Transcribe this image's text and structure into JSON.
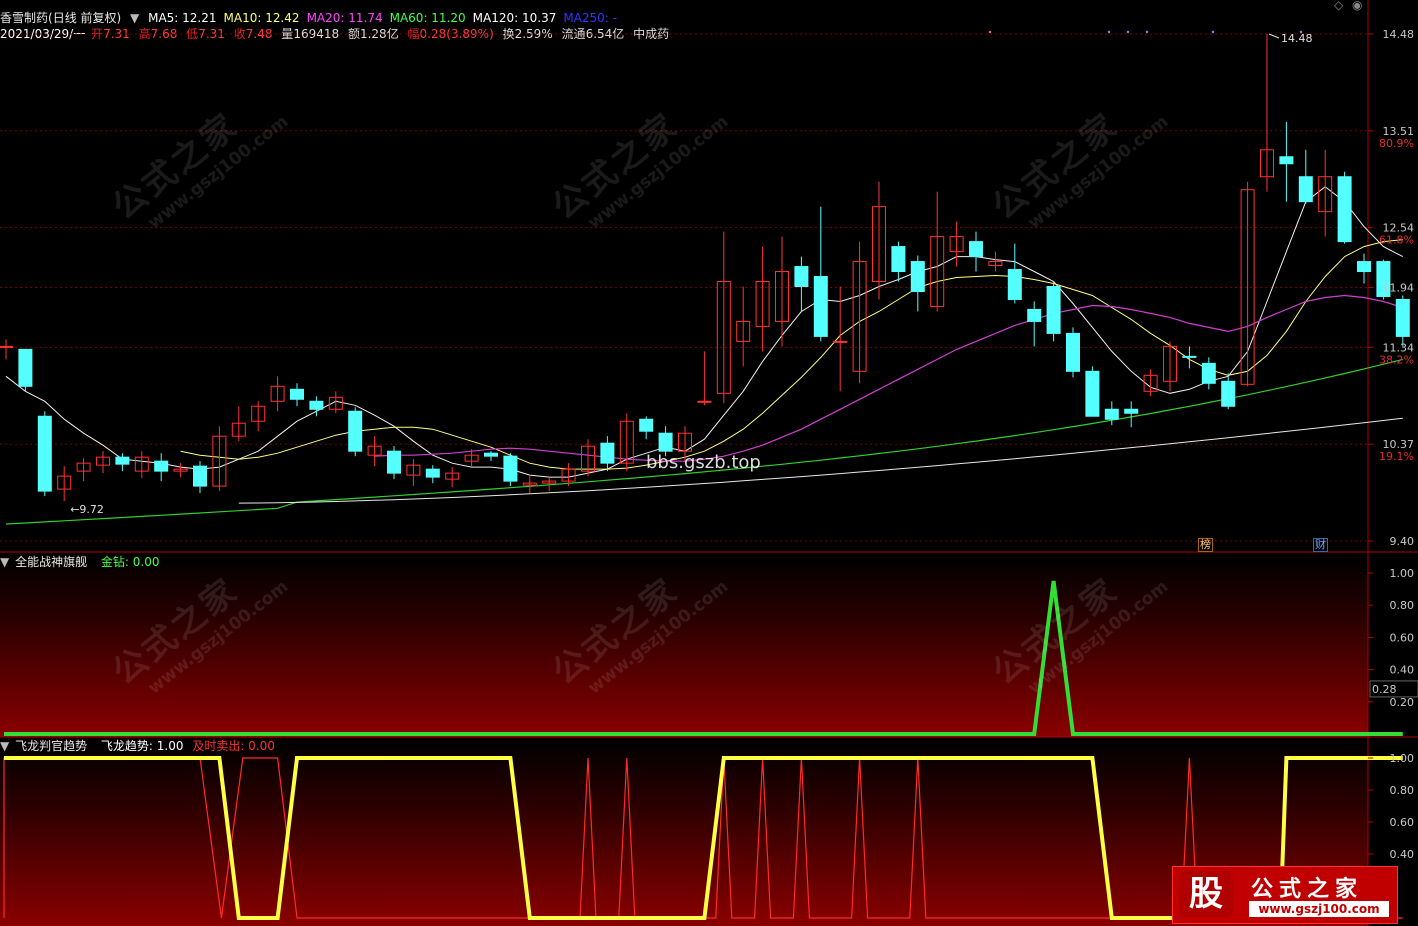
{
  "stock": {
    "name": "香雪制药",
    "mode": "(日线 前复权)",
    "quote_line": {
      "date": "2021/03/29/一",
      "open_label": "开",
      "open": "7.31",
      "high_label": "高",
      "high": "7.68",
      "low_label": "低",
      "low": "7.31",
      "close_label": "收",
      "close": "7.48",
      "vol_label": "量",
      "vol": "169418",
      "amount_label": "额",
      "amount": "1.28亿",
      "chg_label": "幅",
      "chg": "0.28(3.89%)",
      "turnover_label": "换",
      "turnover": "2.59%",
      "float_label": "流通",
      "float": "6.54亿",
      "industry": "中成药"
    }
  },
  "ma_legend": [
    {
      "label": "MA5: 12.21",
      "color": "#ffffff"
    },
    {
      "label": "MA10: 12.42",
      "color": "#ffff66"
    },
    {
      "label": "MA20: 11.74",
      "color": "#ff44ff"
    },
    {
      "label": "MA60: 11.20",
      "color": "#44ff44"
    },
    {
      "label": "MA120: 10.37",
      "color": "#ffffff"
    },
    {
      "label": "MA250: -",
      "color": "#3333ff"
    }
  ],
  "main_axis": {
    "ticks": [
      "14.48",
      "13.51",
      "12.54",
      "11.94",
      "11.34",
      "10.37",
      "9.40"
    ],
    "tick_values": [
      14.48,
      13.51,
      12.54,
      11.94,
      11.34,
      10.37,
      9.4
    ],
    "fib_labels": [
      "80.9%",
      "61.8%",
      "38.2%",
      "19.1%"
    ],
    "fib_values": [
      13.51,
      12.54,
      11.34,
      10.37
    ],
    "high_marker": "14.48",
    "low_marker": "9.72",
    "tags": [
      "榜",
      "财"
    ]
  },
  "watermarks": {
    "line1": "公式之家",
    "line2": "www.gszj100.com",
    "site": "bbs.gszb.top"
  },
  "panel2": {
    "title": "全能战神旗舰",
    "indicator_label": "金钻: 0.00",
    "ticks": [
      "1.00",
      "0.80",
      "0.60",
      "0.40",
      "0.20"
    ],
    "cursor_value": "0.28"
  },
  "panel3": {
    "title": "飞龙判官趋势",
    "indicator_label": "飞龙趋势: 1.00",
    "sell_label": "及时卖出: 0.00",
    "ticks": [
      "1.00",
      "0.80",
      "0.60",
      "0.40"
    ]
  },
  "logo": {
    "mark": "股",
    "name": "公式之家",
    "url": "www.gszj100.com"
  },
  "colors": {
    "up": "#ff3232",
    "down": "#54ffff",
    "grid": "#8b0000"
  },
  "chart_data": {
    "type": "candlestick",
    "candles": [
      {
        "o": 11.35,
        "c": 11.35,
        "h": 11.42,
        "l": 11.22
      },
      {
        "o": 11.32,
        "c": 10.95,
        "h": 11.32,
        "l": 10.9
      },
      {
        "o": 10.65,
        "c": 9.9,
        "h": 10.7,
        "l": 9.85
      },
      {
        "o": 9.92,
        "c": 10.05,
        "h": 10.15,
        "l": 9.8
      },
      {
        "o": 10.1,
        "c": 10.18,
        "h": 10.23,
        "l": 10.0
      },
      {
        "o": 10.16,
        "c": 10.24,
        "h": 10.3,
        "l": 10.08
      },
      {
        "o": 10.24,
        "c": 10.17,
        "h": 10.28,
        "l": 10.1
      },
      {
        "o": 10.1,
        "c": 10.24,
        "h": 10.3,
        "l": 10.03
      },
      {
        "o": 10.2,
        "c": 10.1,
        "h": 10.28,
        "l": 10.0
      },
      {
        "o": 10.1,
        "c": 10.12,
        "h": 10.18,
        "l": 10.04
      },
      {
        "o": 10.15,
        "c": 9.95,
        "h": 10.2,
        "l": 9.88
      },
      {
        "o": 9.95,
        "c": 10.45,
        "h": 10.55,
        "l": 9.9
      },
      {
        "o": 10.45,
        "c": 10.58,
        "h": 10.75,
        "l": 10.4
      },
      {
        "o": 10.6,
        "c": 10.75,
        "h": 10.8,
        "l": 10.5
      },
      {
        "o": 10.8,
        "c": 10.95,
        "h": 11.05,
        "l": 10.7
      },
      {
        "o": 10.92,
        "c": 10.82,
        "h": 10.98,
        "l": 10.75
      },
      {
        "o": 10.8,
        "c": 10.72,
        "h": 10.85,
        "l": 10.65
      },
      {
        "o": 10.72,
        "c": 10.84,
        "h": 10.9,
        "l": 10.68
      },
      {
        "o": 10.7,
        "c": 10.3,
        "h": 10.74,
        "l": 10.25
      },
      {
        "o": 10.26,
        "c": 10.35,
        "h": 10.45,
        "l": 10.15
      },
      {
        "o": 10.3,
        "c": 10.08,
        "h": 10.35,
        "l": 10.02
      },
      {
        "o": 10.06,
        "c": 10.16,
        "h": 10.22,
        "l": 9.95
      },
      {
        "o": 10.12,
        "c": 10.04,
        "h": 10.16,
        "l": 9.98
      },
      {
        "o": 10.02,
        "c": 10.08,
        "h": 10.14,
        "l": 9.94
      },
      {
        "o": 10.2,
        "c": 10.26,
        "h": 10.32,
        "l": 10.14
      },
      {
        "o": 10.28,
        "c": 10.25,
        "h": 10.3,
        "l": 10.2
      },
      {
        "o": 10.25,
        "c": 10.0,
        "h": 10.28,
        "l": 9.95
      },
      {
        "o": 9.96,
        "c": 9.98,
        "h": 10.05,
        "l": 9.88
      },
      {
        "o": 9.98,
        "c": 10.0,
        "h": 10.05,
        "l": 9.9
      },
      {
        "o": 10.0,
        "c": 10.12,
        "h": 10.18,
        "l": 9.95
      },
      {
        "o": 10.1,
        "c": 10.35,
        "h": 10.42,
        "l": 10.05
      },
      {
        "o": 10.38,
        "c": 10.18,
        "h": 10.45,
        "l": 10.1
      },
      {
        "o": 10.18,
        "c": 10.6,
        "h": 10.68,
        "l": 10.1
      },
      {
        "o": 10.62,
        "c": 10.5,
        "h": 10.65,
        "l": 10.42
      },
      {
        "o": 10.48,
        "c": 10.3,
        "h": 10.55,
        "l": 10.25
      },
      {
        "o": 10.3,
        "c": 10.48,
        "h": 10.55,
        "l": 10.2
      },
      {
        "o": 10.8,
        "c": 10.8,
        "h": 11.3,
        "l": 10.76
      },
      {
        "o": 10.88,
        "c": 12.0,
        "h": 12.5,
        "l": 10.78
      },
      {
        "o": 11.4,
        "c": 11.6,
        "h": 11.95,
        "l": 11.15
      },
      {
        "o": 11.55,
        "c": 12.0,
        "h": 12.35,
        "l": 11.3
      },
      {
        "o": 11.6,
        "c": 12.1,
        "h": 12.45,
        "l": 11.35
      },
      {
        "o": 12.15,
        "c": 11.95,
        "h": 12.25,
        "l": 11.7
      },
      {
        "o": 12.05,
        "c": 11.45,
        "h": 12.75,
        "l": 11.4
      },
      {
        "o": 11.4,
        "c": 11.4,
        "h": 11.95,
        "l": 10.9
      },
      {
        "o": 11.1,
        "c": 12.2,
        "h": 12.4,
        "l": 10.98
      },
      {
        "o": 12.0,
        "c": 12.75,
        "h": 13.0,
        "l": 11.82
      },
      {
        "o": 12.35,
        "c": 12.1,
        "h": 12.4,
        "l": 12.0
      },
      {
        "o": 12.2,
        "c": 11.9,
        "h": 12.26,
        "l": 11.7
      },
      {
        "o": 11.75,
        "c": 12.45,
        "h": 12.9,
        "l": 11.7
      },
      {
        "o": 12.3,
        "c": 12.45,
        "h": 12.6,
        "l": 12.15
      },
      {
        "o": 12.4,
        "c": 12.25,
        "h": 12.5,
        "l": 12.1
      },
      {
        "o": 12.16,
        "c": 12.2,
        "h": 12.3,
        "l": 12.1
      },
      {
        "o": 12.12,
        "c": 11.82,
        "h": 12.38,
        "l": 11.78
      },
      {
        "o": 11.72,
        "c": 11.6,
        "h": 11.8,
        "l": 11.35
      },
      {
        "o": 11.95,
        "c": 11.48,
        "h": 12.0,
        "l": 11.4
      },
      {
        "o": 11.48,
        "c": 11.1,
        "h": 11.54,
        "l": 11.04
      },
      {
        "o": 11.1,
        "c": 10.65,
        "h": 11.15,
        "l": 10.65
      },
      {
        "o": 10.72,
        "c": 10.62,
        "h": 10.8,
        "l": 10.56
      },
      {
        "o": 10.72,
        "c": 10.68,
        "h": 10.8,
        "l": 10.54
      },
      {
        "o": 10.9,
        "c": 11.06,
        "h": 11.12,
        "l": 10.85
      },
      {
        "o": 11.0,
        "c": 11.35,
        "h": 11.4,
        "l": 10.9
      },
      {
        "o": 11.25,
        "c": 11.24,
        "h": 11.35,
        "l": 11.13
      },
      {
        "o": 11.18,
        "c": 10.98,
        "h": 11.24,
        "l": 10.92
      },
      {
        "o": 11.0,
        "c": 10.75,
        "h": 11.08,
        "l": 10.72
      },
      {
        "o": 10.97,
        "c": 12.92,
        "h": 13.0,
        "l": 10.95
      },
      {
        "o": 13.05,
        "c": 13.32,
        "h": 14.48,
        "l": 12.9
      },
      {
        "o": 13.25,
        "c": 13.18,
        "h": 13.6,
        "l": 12.8
      },
      {
        "o": 13.05,
        "c": 12.8,
        "h": 13.32,
        "l": 12.78
      },
      {
        "o": 12.7,
        "c": 13.05,
        "h": 13.32,
        "l": 12.45
      },
      {
        "o": 13.05,
        "c": 12.4,
        "h": 13.1,
        "l": 12.38
      },
      {
        "o": 12.2,
        "c": 12.1,
        "h": 12.28,
        "l": 11.98
      },
      {
        "o": 12.2,
        "c": 11.85,
        "h": 12.22,
        "l": 11.82
      },
      {
        "o": 11.82,
        "c": 11.45,
        "h": 11.86,
        "l": 11.35
      }
    ],
    "ma5": [
      11.05,
      10.9,
      10.8,
      10.62,
      10.48,
      10.36,
      10.22,
      10.2,
      10.18,
      10.14,
      10.12,
      10.14,
      10.22,
      10.3,
      10.45,
      10.6,
      10.7,
      10.8,
      10.76,
      10.66,
      10.55,
      10.4,
      10.26,
      10.18,
      10.14,
      10.14,
      10.12,
      10.06,
      10.04,
      10.04,
      10.08,
      10.12,
      10.22,
      10.28,
      10.34,
      10.3,
      10.42,
      10.66,
      10.9,
      11.2,
      11.46,
      11.7,
      11.82,
      11.8,
      11.86,
      11.95,
      12.02,
      12.1,
      12.15,
      12.25,
      12.25,
      12.22,
      12.2,
      12.1,
      12.0,
      11.78,
      11.54,
      11.3,
      11.1,
      10.94,
      10.88,
      10.92,
      11.0,
      11.05,
      11.3,
      11.8,
      12.3,
      12.8,
      12.95,
      12.8,
      12.55,
      12.35,
      12.25
    ],
    "ma10": [
      null,
      null,
      null,
      null,
      null,
      null,
      null,
      null,
      null,
      10.3,
      10.26,
      10.24,
      10.22,
      10.24,
      10.28,
      10.34,
      10.4,
      10.46,
      10.5,
      10.52,
      10.54,
      10.54,
      10.52,
      10.46,
      10.4,
      10.34,
      10.26,
      10.18,
      10.14,
      10.12,
      10.12,
      10.12,
      10.13,
      10.16,
      10.2,
      10.24,
      10.3,
      10.4,
      10.52,
      10.68,
      10.86,
      11.04,
      11.24,
      11.46,
      11.6,
      11.7,
      11.82,
      11.94,
      12.0,
      12.04,
      12.05,
      12.06,
      12.05,
      12.02,
      11.98,
      11.92,
      11.86,
      11.74,
      11.62,
      11.48,
      11.36,
      11.22,
      11.12,
      11.06,
      11.1,
      11.26,
      11.5,
      11.8,
      12.05,
      12.25,
      12.35,
      12.4,
      12.42
    ],
    "ma20": [
      null,
      null,
      null,
      null,
      null,
      null,
      null,
      null,
      null,
      null,
      null,
      null,
      null,
      null,
      null,
      null,
      null,
      null,
      null,
      10.25,
      10.26,
      10.26,
      10.27,
      10.28,
      10.3,
      10.32,
      10.33,
      10.32,
      10.3,
      10.28,
      10.26,
      10.24,
      10.22,
      10.21,
      10.2,
      10.2,
      10.22,
      10.25,
      10.3,
      10.36,
      10.44,
      10.52,
      10.62,
      10.72,
      10.82,
      10.92,
      11.02,
      11.12,
      11.22,
      11.32,
      11.4,
      11.48,
      11.56,
      11.62,
      11.68,
      11.72,
      11.76,
      11.75,
      11.72,
      11.68,
      11.64,
      11.58,
      11.54,
      11.5,
      11.55,
      11.64,
      11.72,
      11.8,
      11.84,
      11.86,
      11.84,
      11.8,
      11.74
    ]
  }
}
